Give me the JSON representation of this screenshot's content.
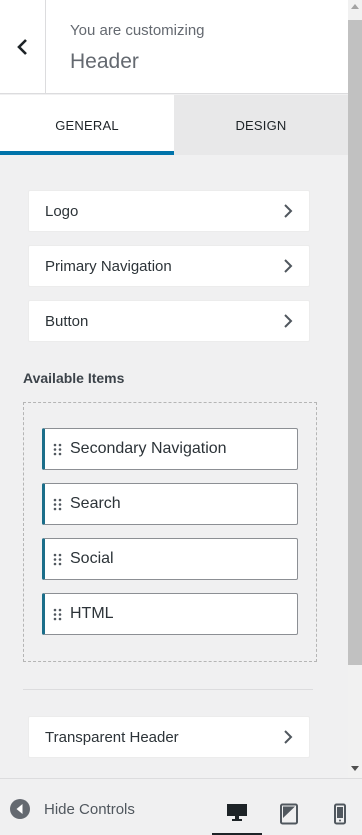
{
  "header": {
    "subtitle": "You are customizing",
    "title": "Header",
    "back_icon": "chevron-left-icon"
  },
  "tabs": [
    {
      "label": "General",
      "active": true
    },
    {
      "label": "Design",
      "active": false
    }
  ],
  "items": [
    {
      "label": "Logo"
    },
    {
      "label": "Primary Navigation"
    },
    {
      "label": "Button"
    }
  ],
  "available": {
    "title": "Available Items",
    "chips": [
      {
        "label": "Secondary Navigation"
      },
      {
        "label": "Search"
      },
      {
        "label": "Social"
      },
      {
        "label": "HTML"
      }
    ]
  },
  "transparent_header": {
    "label": "Transparent Header"
  },
  "footer": {
    "hide_label": "Hide Controls",
    "devices": [
      "desktop-icon",
      "tablet-icon",
      "mobile-icon"
    ]
  },
  "colors": {
    "accent": "#0073aa",
    "chip_border": "#1b6e8a"
  }
}
